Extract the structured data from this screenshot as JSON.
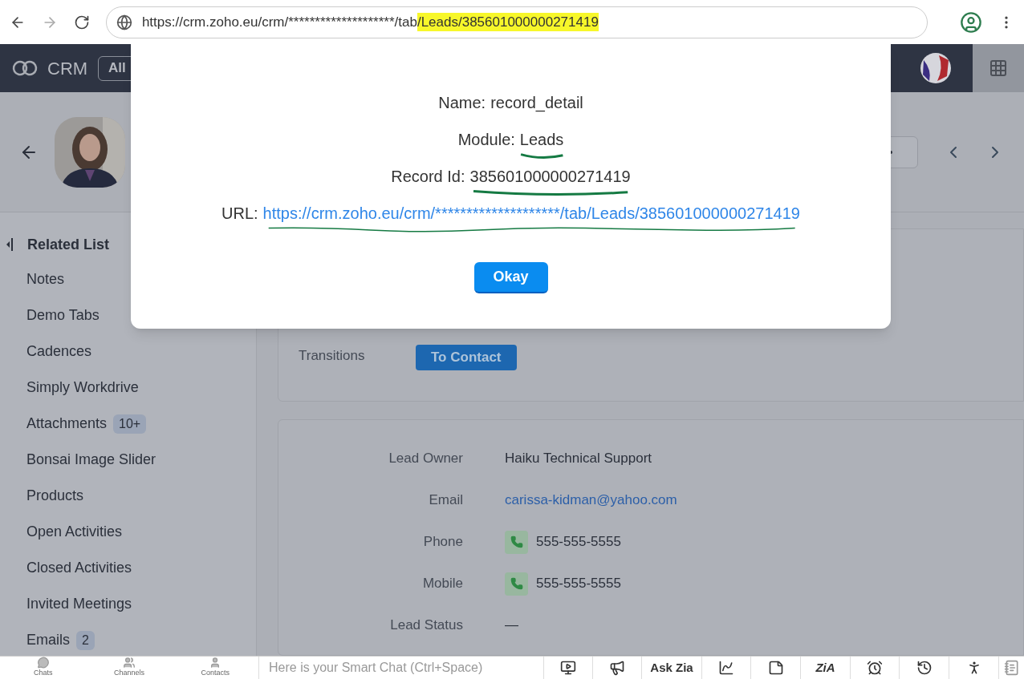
{
  "browser": {
    "url": "https://crm.zoho.eu/crm/********************/tab",
    "url_highlight": "/Leads/385601000000271419"
  },
  "app_header": {
    "logo": "CRM",
    "tab": "All"
  },
  "dialog": {
    "lines": [
      {
        "label": "Name:",
        "value": "record_detail",
        "kind": "plain",
        "underlined": false
      },
      {
        "label": "Module:",
        "value": "Leads",
        "kind": "plain",
        "underlined": true
      },
      {
        "label": "Record Id:",
        "value": "385601000000271419",
        "kind": "plain",
        "underlined": true
      },
      {
        "label": "URL:",
        "value": "https://crm.zoho.eu/crm/********************/tab/Leads/385601000000271419",
        "kind": "link",
        "underlined": true
      }
    ],
    "button": "Okay"
  },
  "sidebar": {
    "heading": "Related List",
    "items": [
      {
        "label": "Notes"
      },
      {
        "label": "Demo Tabs"
      },
      {
        "label": "Cadences"
      },
      {
        "label": "Simply Workdrive"
      },
      {
        "label": "Attachments",
        "badge": "10+"
      },
      {
        "label": "Bonsai Image Slider"
      },
      {
        "label": "Products"
      },
      {
        "label": "Open Activities"
      },
      {
        "label": "Closed Activities"
      },
      {
        "label": "Invited Meetings"
      },
      {
        "label": "Emails",
        "badge": "2"
      }
    ]
  },
  "transitions": {
    "label": "Transitions",
    "button": "To Contact"
  },
  "fields": [
    {
      "label": "Lead Owner",
      "value": "Haiku Technical Support",
      "kind": "text"
    },
    {
      "label": "Email",
      "value": "carissa-kidman@yahoo.com",
      "kind": "email"
    },
    {
      "label": "Phone",
      "value": "555-555-5555",
      "kind": "phone"
    },
    {
      "label": "Mobile",
      "value": "555-555-5555",
      "kind": "phone"
    },
    {
      "label": "Lead Status",
      "value": "—",
      "kind": "text"
    }
  ],
  "bottom_bar": {
    "nav": [
      {
        "label": "Chats"
      },
      {
        "label": "Channels"
      },
      {
        "label": "Contacts"
      }
    ],
    "chat_placeholder": "Here is your Smart Chat (Ctrl+Space)",
    "ask_zia": "Ask Zia",
    "zia_logo": "ZiA"
  }
}
